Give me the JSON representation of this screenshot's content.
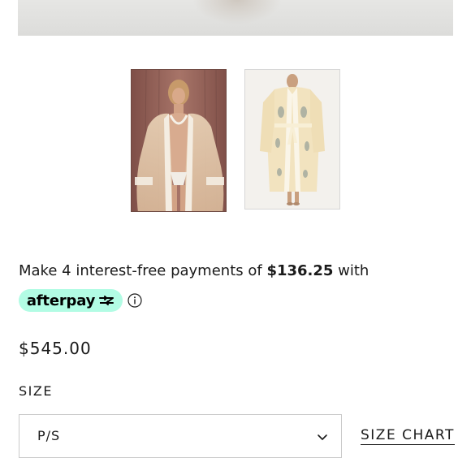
{
  "product": {
    "images": [
      {
        "name": "main-product-image"
      },
      {
        "name": "thumbnail-model-robe"
      },
      {
        "name": "thumbnail-robe-front"
      }
    ],
    "installments": {
      "prefix": "Make 4 interest-free payments of ",
      "amount": "$136.25",
      "suffix": " with",
      "provider": "afterpay",
      "brand_color": "#b2fce4"
    },
    "price": "$545.00",
    "size": {
      "label": "SIZE",
      "selected": "P/S",
      "chart_link": "SIZE CHART"
    }
  }
}
